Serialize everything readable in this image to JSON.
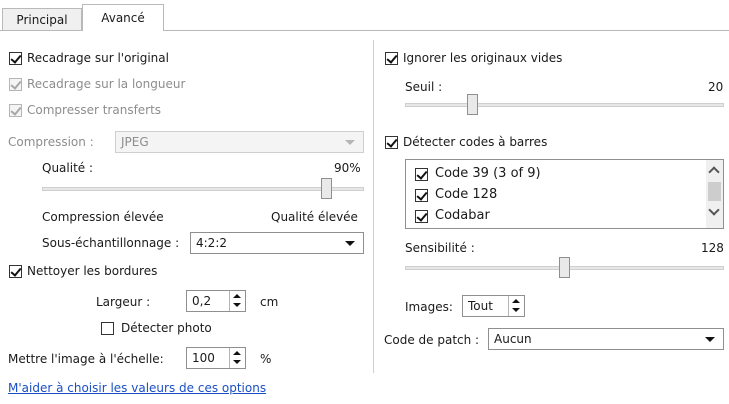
{
  "tabs": {
    "principal": "Principal",
    "avance": "Avancé"
  },
  "left": {
    "recadrage_original": "Recadrage sur l'original",
    "recadrage_longueur": "Recadrage sur la longueur",
    "compresser": "Compresser transferts",
    "compression_label": "Compression :",
    "compression_value": "JPEG",
    "qualite_label": "Qualité :",
    "qualite_value": "90%",
    "qualite_level": 0.9,
    "compression_elevee": "Compression élevée",
    "qualite_elevee": "Qualité élevée",
    "sous_echantillonnage_label": "Sous-échantillonnage :",
    "sous_echantillonnage_value": "4:2:2",
    "nettoyer": "Nettoyer les bordures",
    "largeur_label": "Largeur :",
    "largeur_value": "0,2",
    "largeur_unit": "cm",
    "detecter_photo": "Détecter photo",
    "echelle_label": "Mettre l'image à l'échelle:",
    "echelle_value": "100",
    "echelle_unit": "%"
  },
  "right": {
    "ignorer": "Ignorer les originaux vides",
    "seuil_label": "Seuil :",
    "seuil_value": "20",
    "detecter_codes": "Détecter codes à barres",
    "barcodes": [
      "Code 39 (3 of 9)",
      "Code 128",
      "Codabar"
    ],
    "sensibilite_label": "Sensibilité :",
    "sensibilite_value": "128",
    "images_label": "Images:",
    "images_value": "Tout",
    "patch_label": "Code de patch :",
    "patch_value": "Aucun"
  },
  "help_link": "M'aider à choisir les valeurs de ces options"
}
